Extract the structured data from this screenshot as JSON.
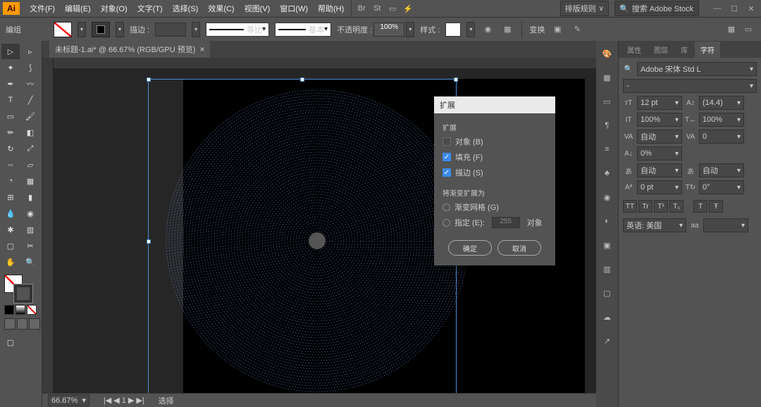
{
  "app_logo": "Ai",
  "menubar": {
    "items": [
      "文件(F)",
      "编辑(E)",
      "对象(O)",
      "文字(T)",
      "选择(S)",
      "效果(C)",
      "视图(V)",
      "窗口(W)",
      "帮助(H)"
    ],
    "layout_label": "排版规则",
    "search_placeholder": "搜索 Adobe Stock"
  },
  "optbar": {
    "group_label": "编组",
    "stroke_label": "描边 :",
    "stroke_val": "",
    "dash_label": "等比",
    "basic_label": "基本",
    "opacity_label": "不透明度 :",
    "opacity_val": "100%",
    "style_label": "样式 :",
    "transform_label": "变换",
    "align_label": ""
  },
  "doc_tab": {
    "title": "未标题-1.ai* @ 66.67% (RGB/GPU 预览)"
  },
  "statusbar": {
    "zoom": "66.67%",
    "mode": "选择"
  },
  "panel_tabs": [
    "属性",
    "图层",
    "库",
    "字符"
  ],
  "char": {
    "font_search": "Adobe 宋体 Std L",
    "style": "-",
    "size": "12 pt",
    "leading": "(14.4)",
    "hscale": "100%",
    "vscale": "100%",
    "kerning": "自动",
    "tracking": "0",
    "baseline": "0%",
    "auto": "自动",
    "shift": "0 pt",
    "rotate": "0°",
    "lang": "英语: 美国",
    "aa": "aa",
    "btns": [
      "TT",
      "Tr",
      "T¹",
      "T₁",
      "T",
      "Ŧ"
    ]
  },
  "dialog": {
    "title": "扩展",
    "group": "扩展",
    "obj": "对象 (B)",
    "fill": "填充 (F)",
    "stroke": "描边 (S)",
    "sec2_label": "将渐变扩展为",
    "grad_mesh": "渐变网格 (G)",
    "specify": "指定 (E):",
    "specify_val": "255",
    "specify_unit": "对象",
    "ok": "确定",
    "cancel": "取消"
  },
  "win": {
    "min": "—",
    "max": "☐",
    "close": "✕"
  }
}
